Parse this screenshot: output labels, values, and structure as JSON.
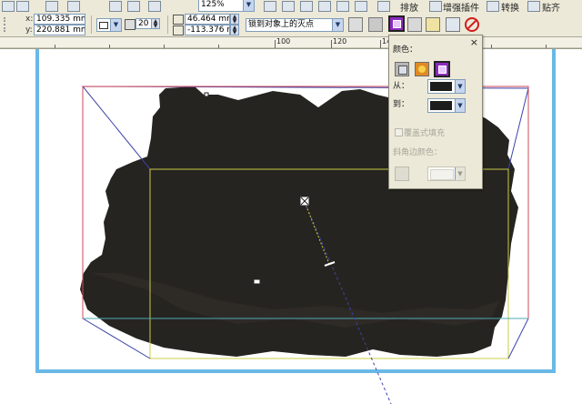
{
  "toolbar": {
    "menu_labels": [
      "排放",
      "增强插件",
      "转换",
      "贴齐"
    ],
    "zoom": "125%"
  },
  "properties": {
    "x": "109.335 mm",
    "y": "220.881 mm",
    "x_label": "x:",
    "y_label": "y:",
    "depth": "20",
    "vp_x": "46.464 mm",
    "vp_y": "-113.376 mm",
    "vanishing_point_mode": "锁到对象上的灭点"
  },
  "ruler": {
    "ticks": [
      "100",
      "120",
      "140"
    ]
  },
  "color_popup": {
    "title": "颜色：",
    "from_label": "从：",
    "to_label": "到：",
    "from_color": "#1d1d1d",
    "to_color": "#1d1d1d",
    "overlay_fill_label": "覆盖式填充",
    "bevel_color_label": "斜角边颜色：",
    "close": "×"
  },
  "colors": {
    "frame_blue": "#6ab8e6",
    "object_fill": "#262420",
    "bbox_red": "#d24a5a",
    "front_face_yellow": "#c8cc4a",
    "vanish_blue": "#3a44a8",
    "accent_purple": "#8a2bbd"
  }
}
